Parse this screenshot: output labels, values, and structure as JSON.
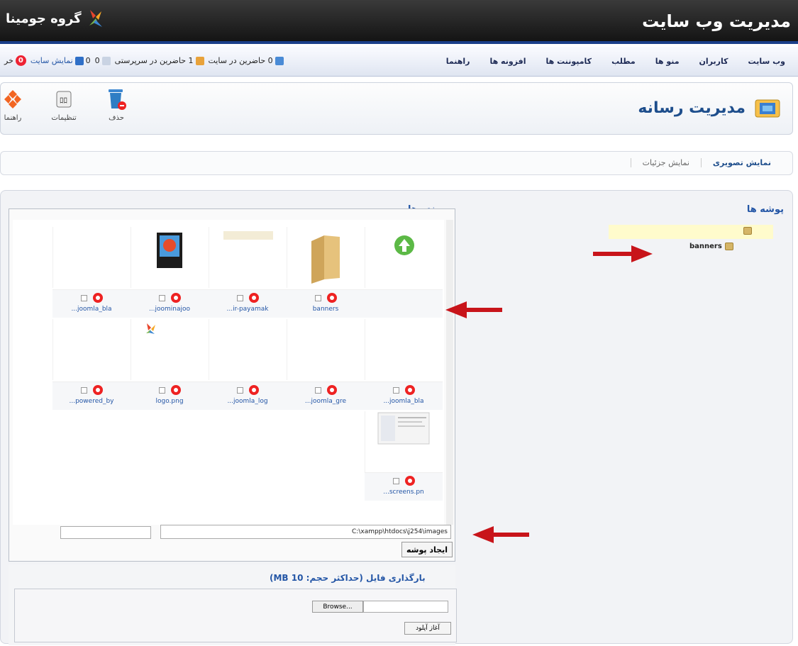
{
  "header": {
    "site_title": "مدیریت وب سایت",
    "brand": "گروه جومینا"
  },
  "menu": [
    "وب سایت",
    "کاربران",
    "منو ها",
    "مطلب",
    "کامپوننت ها",
    "افزونه ها",
    "راهنما"
  ],
  "status": {
    "online_site": "0 حاضرین در سایت",
    "online_admin": "1 حاضرین در سرپرستی",
    "messages": "0",
    "view_site_count": "0",
    "view_site": "نمایش سایت",
    "logout_badge": "0",
    "logout": "خر"
  },
  "toolbar": {
    "delete": "حذف",
    "settings": "تنظیمات",
    "help": "راهنما"
  },
  "page_title": "مدیریت رسانه",
  "view_tabs": {
    "thumbnails": "نمایش تصویری",
    "details": "نمایش جزئیات"
  },
  "folders": {
    "title": "پوشه ها",
    "child": "banners"
  },
  "files": {
    "title": "پرونده ها",
    "row1": [
      "",
      "banners",
      "...ir-payamak",
      "...joominajoo",
      "...joomla_bla"
    ],
    "row2": [
      "...joomla_bla",
      "...joomla_gre",
      "...joomla_log",
      "logo.png",
      "...powered_by"
    ],
    "row3": [
      "...screens.pn"
    ]
  },
  "path_value": "C:\\xampp\\htdocs\\j254\\images",
  "create_folder": "ایجاد پوشه",
  "upload": {
    "title": "بارگذاری فایل (حداکثر حجم: 10 MB)",
    "browse": "Browse...",
    "start": "آغاز آپلود"
  },
  "colors": {
    "header": "#1a1a1a",
    "accent": "#2456a6",
    "arrow": "#c8141a"
  }
}
